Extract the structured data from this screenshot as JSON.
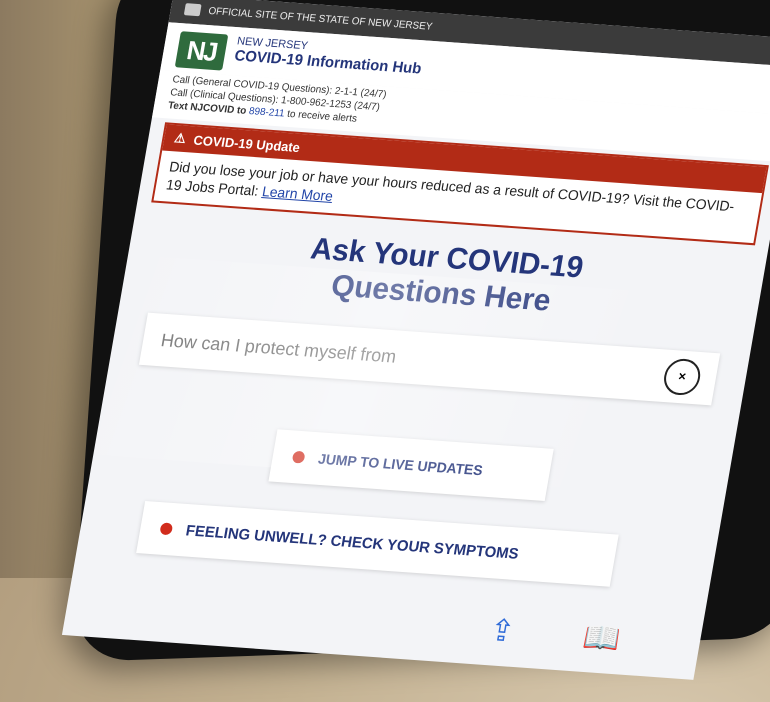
{
  "gov_bar": {
    "text": "OFFICIAL SITE OF THE STATE OF NEW JERSEY"
  },
  "header": {
    "logo": "NJ",
    "state": "NEW JERSEY",
    "title": "COVID-19 Information Hub"
  },
  "contact": {
    "line1": "Call (General COVID-19 Questions): 2-1-1 (24/7)",
    "line2": "Call (Clinical Questions): 1-800-962-1253 (24/7)",
    "line3_prefix": "Text NJCOVID to ",
    "line3_number": "898-211",
    "line3_suffix": " to receive alerts"
  },
  "alert": {
    "title": "COVID-19 Update",
    "body": "Did you lose your job or have your hours reduced as a result of COVID-19? Visit the COVID-19 Jobs Portal: ",
    "link": "Learn More"
  },
  "ask": {
    "line1": "Ask Your COVID-19",
    "line2": "Questions Here"
  },
  "search": {
    "placeholder": "How can I protect myself from"
  },
  "buttons": {
    "live_updates": "JUMP TO LIVE UPDATES",
    "unwell": "FEELING UNWELL? CHECK YOUR SYMPTOMS"
  },
  "colors": {
    "brand_blue": "#24357a",
    "alert_red": "#b22b16",
    "dot_red": "#d12c1c"
  }
}
